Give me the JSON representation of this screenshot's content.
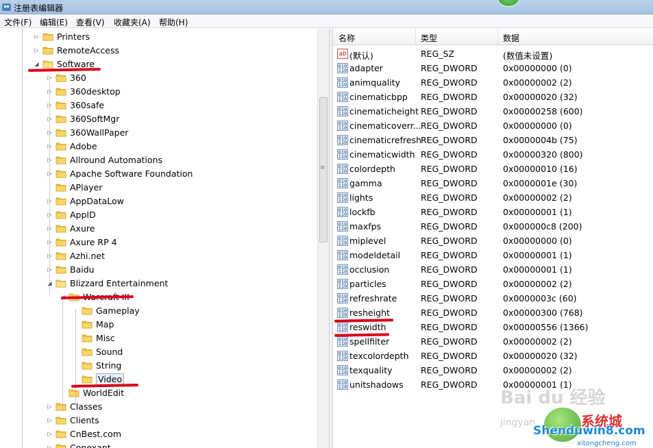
{
  "window": {
    "title": "注册表编辑器"
  },
  "menu": [
    "文件(F)",
    "编辑(E)",
    "查看(V)",
    "收藏夹(A)",
    "帮助(H)"
  ],
  "tree": {
    "items": [
      {
        "label": "Printers",
        "expander": "closed"
      },
      {
        "label": "RemoteAccess",
        "expander": "closed"
      },
      {
        "label": "Software",
        "expander": "open"
      },
      {
        "label": "360",
        "expander": "closed"
      },
      {
        "label": "360desktop",
        "expander": "closed"
      },
      {
        "label": "360safe",
        "expander": "closed"
      },
      {
        "label": "360SoftMgr",
        "expander": "closed"
      },
      {
        "label": "360WallPaper",
        "expander": "closed"
      },
      {
        "label": "Adobe",
        "expander": "closed"
      },
      {
        "label": "Allround Automations",
        "expander": "closed"
      },
      {
        "label": "Apache Software Foundation",
        "expander": "closed"
      },
      {
        "label": "APlayer",
        "expander": "none"
      },
      {
        "label": "AppDataLow",
        "expander": "closed"
      },
      {
        "label": "AppID",
        "expander": "closed"
      },
      {
        "label": "Axure",
        "expander": "closed"
      },
      {
        "label": "Axure RP 4",
        "expander": "closed"
      },
      {
        "label": "Azhi.net",
        "expander": "closed"
      },
      {
        "label": "Baidu",
        "expander": "closed"
      },
      {
        "label": "Blizzard Entertainment",
        "expander": "open"
      },
      {
        "label": "Warcraft III",
        "expander": "open"
      },
      {
        "label": "Gameplay",
        "expander": "none"
      },
      {
        "label": "Map",
        "expander": "none"
      },
      {
        "label": "Misc",
        "expander": "none"
      },
      {
        "label": "Sound",
        "expander": "none"
      },
      {
        "label": "String",
        "expander": "none"
      },
      {
        "label": "Video",
        "expander": "none",
        "selected": true
      },
      {
        "label": "WorldEdit",
        "expander": "none"
      },
      {
        "label": "Classes",
        "expander": "closed"
      },
      {
        "label": "Clients",
        "expander": "closed"
      },
      {
        "label": "CnBest.com",
        "expander": "closed"
      },
      {
        "label": "Conexant",
        "expander": "closed"
      }
    ]
  },
  "list": {
    "columns": [
      "名称",
      "类型",
      "数据"
    ],
    "rows": [
      {
        "name": "(默认)",
        "type": "REG_SZ",
        "data": "(数值未设置)",
        "icon": "string-value-icon"
      },
      {
        "name": "adapter",
        "type": "REG_DWORD",
        "data": "0x00000000 (0)",
        "icon": "binary-value-icon"
      },
      {
        "name": "animquality",
        "type": "REG_DWORD",
        "data": "0x00000002 (2)",
        "icon": "binary-value-icon"
      },
      {
        "name": "cinematicbpp",
        "type": "REG_DWORD",
        "data": "0x00000020 (32)",
        "icon": "binary-value-icon"
      },
      {
        "name": "cinematicheight",
        "type": "REG_DWORD",
        "data": "0x00000258 (600)",
        "icon": "binary-value-icon"
      },
      {
        "name": "cinematicoverr...",
        "type": "REG_DWORD",
        "data": "0x00000000 (0)",
        "icon": "binary-value-icon"
      },
      {
        "name": "cinematicrefresh",
        "type": "REG_DWORD",
        "data": "0x0000004b (75)",
        "icon": "binary-value-icon"
      },
      {
        "name": "cinematicwidth",
        "type": "REG_DWORD",
        "data": "0x00000320 (800)",
        "icon": "binary-value-icon"
      },
      {
        "name": "colordepth",
        "type": "REG_DWORD",
        "data": "0x00000010 (16)",
        "icon": "binary-value-icon"
      },
      {
        "name": "gamma",
        "type": "REG_DWORD",
        "data": "0x0000001e (30)",
        "icon": "binary-value-icon"
      },
      {
        "name": "lights",
        "type": "REG_DWORD",
        "data": "0x00000002 (2)",
        "icon": "binary-value-icon"
      },
      {
        "name": "lockfb",
        "type": "REG_DWORD",
        "data": "0x00000001 (1)",
        "icon": "binary-value-icon"
      },
      {
        "name": "maxfps",
        "type": "REG_DWORD",
        "data": "0x000000c8 (200)",
        "icon": "binary-value-icon"
      },
      {
        "name": "miplevel",
        "type": "REG_DWORD",
        "data": "0x00000000 (0)",
        "icon": "binary-value-icon"
      },
      {
        "name": "modeldetail",
        "type": "REG_DWORD",
        "data": "0x00000001 (1)",
        "icon": "binary-value-icon"
      },
      {
        "name": "occlusion",
        "type": "REG_DWORD",
        "data": "0x00000001 (1)",
        "icon": "binary-value-icon"
      },
      {
        "name": "particles",
        "type": "REG_DWORD",
        "data": "0x00000002 (2)",
        "icon": "binary-value-icon"
      },
      {
        "name": "refreshrate",
        "type": "REG_DWORD",
        "data": "0x0000003c (60)",
        "icon": "binary-value-icon"
      },
      {
        "name": "resheight",
        "type": "REG_DWORD",
        "data": "0x00000300 (768)",
        "icon": "binary-value-icon"
      },
      {
        "name": "reswidth",
        "type": "REG_DWORD",
        "data": "0x00000556 (1366)",
        "icon": "binary-value-icon"
      },
      {
        "name": "spellfilter",
        "type": "REG_DWORD",
        "data": "0x00000002 (2)",
        "icon": "binary-value-icon"
      },
      {
        "name": "texcolordepth",
        "type": "REG_DWORD",
        "data": "0x00000020 (32)",
        "icon": "binary-value-icon"
      },
      {
        "name": "texquality",
        "type": "REG_DWORD",
        "data": "0x00000002 (2)",
        "icon": "binary-value-icon"
      },
      {
        "name": "unitshadows",
        "type": "REG_DWORD",
        "data": "0x00000001 (1)",
        "icon": "binary-value-icon"
      }
    ]
  },
  "watermark": {
    "baidu": "Bai du 经验",
    "jingyan": "jingyan",
    "brand": "系统城",
    "site": "Shenduwin8.com",
    "site2": "xitongcheng.com"
  },
  "colors": {
    "annotation_red": "#d9001b",
    "folder_yellow": "#f2c94c",
    "selection_bg": "#e8f0fb"
  }
}
